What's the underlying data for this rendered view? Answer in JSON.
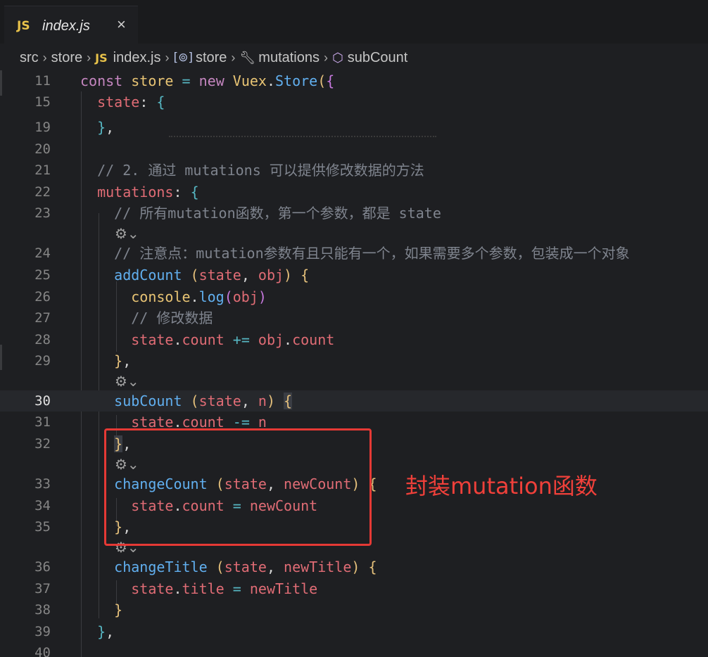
{
  "tab": {
    "badge": "JS",
    "title": "index.js",
    "close": "×"
  },
  "breadcrumb": {
    "items": [
      "src",
      "store",
      "index.js",
      "store",
      "mutations",
      "subCount"
    ],
    "file_badge": "JS"
  },
  "annotation": {
    "text": "封装mutation函数"
  },
  "colors": {
    "annotation": "#f0403a",
    "box": "#e53935"
  },
  "editor": {
    "active_line": "30",
    "lines": [
      {
        "n": "11",
        "parts": [
          "const",
          "store",
          "=",
          "new",
          "Vuex",
          ".",
          "Store",
          "(",
          "{"
        ]
      },
      {
        "n": "15",
        "parts": [
          "state",
          ":",
          "{"
        ]
      },
      {
        "n": "19",
        "parts": [
          "}",
          ","
        ]
      },
      {
        "n": "20",
        "parts": []
      },
      {
        "n": "21",
        "parts": [
          "// 2. 通过 mutations 可以提供修改数据的方法"
        ]
      },
      {
        "n": "22",
        "parts": [
          "mutations",
          ":",
          "{"
        ]
      },
      {
        "n": "23",
        "parts": [
          "// 所有mutation函数，第一个参数，都是 state"
        ]
      },
      {
        "n": "24",
        "parts": [
          "// 注意点：mutation参数有且只能有一个，如果需要多个参数，包装成一个对象"
        ]
      },
      {
        "n": "25",
        "parts": [
          "addCount",
          "(",
          "state",
          ",",
          "obj",
          ")",
          "{"
        ]
      },
      {
        "n": "26",
        "parts": [
          "console",
          ".",
          "log",
          "(",
          "obj",
          ")"
        ]
      },
      {
        "n": "27",
        "parts": [
          "// 修改数据"
        ]
      },
      {
        "n": "28",
        "parts": [
          "state",
          ".",
          "count",
          "+=",
          "obj",
          ".",
          "count"
        ]
      },
      {
        "n": "29",
        "parts": [
          "}",
          ","
        ]
      },
      {
        "n": "30",
        "parts": [
          "subCount",
          "(",
          "state",
          ",",
          "n",
          ")",
          "{"
        ]
      },
      {
        "n": "31",
        "parts": [
          "state",
          ".",
          "count",
          "-=",
          "n"
        ]
      },
      {
        "n": "32",
        "parts": [
          "}",
          ","
        ]
      },
      {
        "n": "33",
        "parts": [
          "changeCount",
          "(",
          "state",
          ",",
          "newCount",
          ")",
          "{"
        ]
      },
      {
        "n": "34",
        "parts": [
          "state",
          ".",
          "count",
          "=",
          "newCount"
        ]
      },
      {
        "n": "35",
        "parts": [
          "}",
          ","
        ]
      },
      {
        "n": "36",
        "parts": [
          "changeTitle",
          "(",
          "state",
          ",",
          "newTitle",
          ")",
          "{"
        ]
      },
      {
        "n": "37",
        "parts": [
          "state",
          ".",
          "title",
          "=",
          "newTitle"
        ]
      },
      {
        "n": "38",
        "parts": [
          "}"
        ]
      },
      {
        "n": "39",
        "parts": [
          "}",
          ","
        ]
      },
      {
        "n": "40",
        "parts": []
      }
    ]
  }
}
